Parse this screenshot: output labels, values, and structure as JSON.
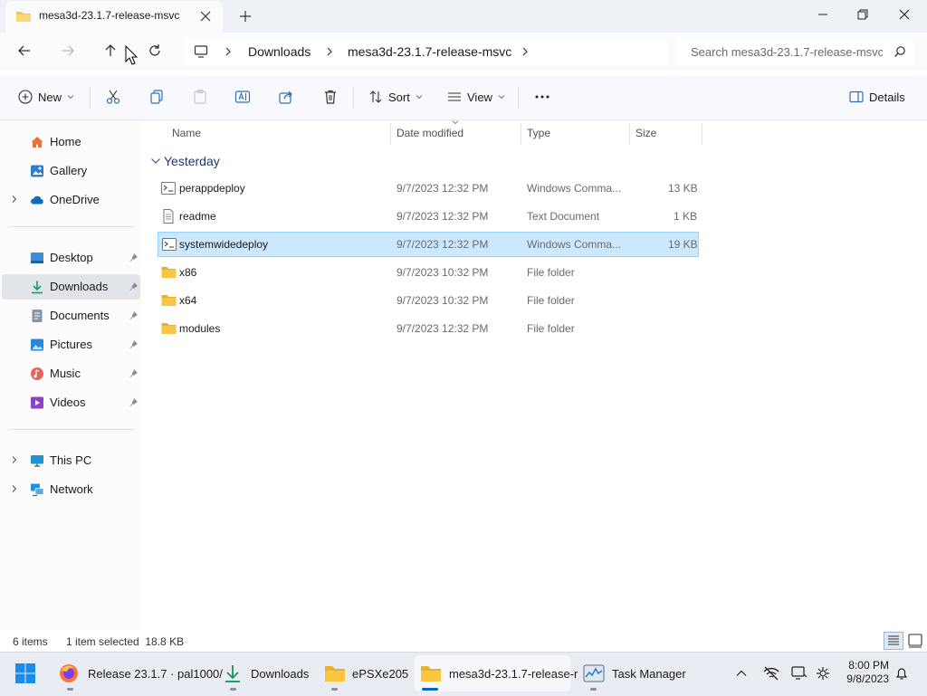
{
  "window": {
    "tab_title": "mesa3d-23.1.7-release-msvc"
  },
  "address": {
    "crumbs": [
      "Downloads",
      "mesa3d-23.1.7-release-msvc"
    ],
    "search_placeholder": "Search mesa3d-23.1.7-release-msvc"
  },
  "commands": {
    "new": "New",
    "sort": "Sort",
    "view": "View",
    "details": "Details"
  },
  "nav": {
    "home": "Home",
    "gallery": "Gallery",
    "onedrive": "OneDrive",
    "desktop": "Desktop",
    "downloads": "Downloads",
    "documents": "Documents",
    "pictures": "Pictures",
    "music": "Music",
    "videos": "Videos",
    "thispc": "This PC",
    "network": "Network"
  },
  "columns": [
    "Name",
    "Date modified",
    "Type",
    "Size"
  ],
  "group_label": "Yesterday",
  "files": [
    {
      "name": "perappdeploy",
      "date": "9/7/2023 12:32 PM",
      "type": "Windows Comma...",
      "size": "13 KB",
      "icon": "cmd-script-icon"
    },
    {
      "name": "readme",
      "date": "9/7/2023 12:32 PM",
      "type": "Text Document",
      "size": "1 KB",
      "icon": "text-file-icon"
    },
    {
      "name": "systemwidedeploy",
      "date": "9/7/2023 12:32 PM",
      "type": "Windows Comma...",
      "size": "19 KB",
      "icon": "cmd-script-icon",
      "selected": true
    },
    {
      "name": "x86",
      "date": "9/7/2023 10:32 PM",
      "type": "File folder",
      "size": "",
      "icon": "folder-icon"
    },
    {
      "name": "x64",
      "date": "9/7/2023 10:32 PM",
      "type": "File folder",
      "size": "",
      "icon": "folder-icon"
    },
    {
      "name": "modules",
      "date": "9/7/2023 12:32 PM",
      "type": "File folder",
      "size": "",
      "icon": "folder-icon"
    }
  ],
  "status": {
    "items": "6 items",
    "selection": "1 item selected  18.8 KB"
  },
  "taskbar": {
    "firefox": "Release 23.1.7 · pal1000/",
    "downloads": "Downloads",
    "epsxe": "ePSXe205",
    "explorer": "mesa3d-23.1.7-release-r",
    "taskmgr": "Task Manager",
    "time": "8:00 PM",
    "date": "9/8/2023"
  },
  "colors": {
    "selection": "#cce8ff",
    "accent": "#0067c0",
    "folder": "#f8c640"
  }
}
